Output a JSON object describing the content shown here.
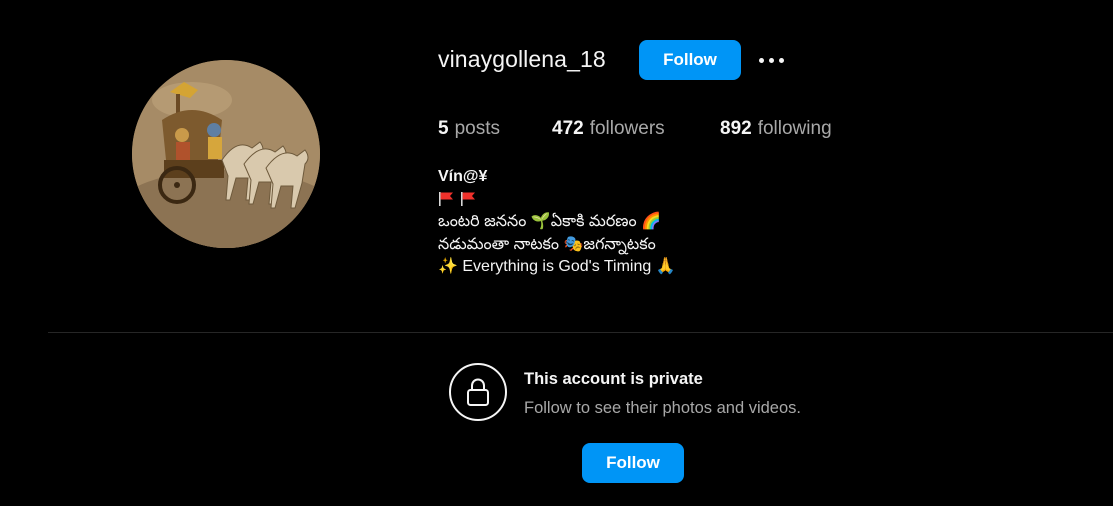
{
  "profile": {
    "username": "vinaygollena_18",
    "follow_label": "Follow",
    "more_icon": "more-options-icon",
    "stats": {
      "posts_count": "5",
      "posts_label": "posts",
      "followers_count": "472",
      "followers_label": "followers",
      "following_count": "892",
      "following_label": "following"
    },
    "bio": {
      "display_name": "Vín@¥",
      "line2_text": "ఒంటరి జననం 🌱ఏకాకి మరణం 🌈",
      "line3_text": "నడుమంతా నాటకం 🎭జగన్నాటకం",
      "line4_text": "✨ Everything is God's Timing 🙏"
    },
    "avatar_icon": "chariot-painting"
  },
  "private_notice": {
    "title": "This account is private",
    "subtitle": "Follow to see their photos and videos.",
    "follow_label": "Follow",
    "lock_icon": "lock-icon"
  },
  "colors": {
    "background": "#000000",
    "accent": "#0095f6",
    "text_primary": "#f5f5f5",
    "text_secondary": "#a8a8a8",
    "divider": "#262626"
  }
}
